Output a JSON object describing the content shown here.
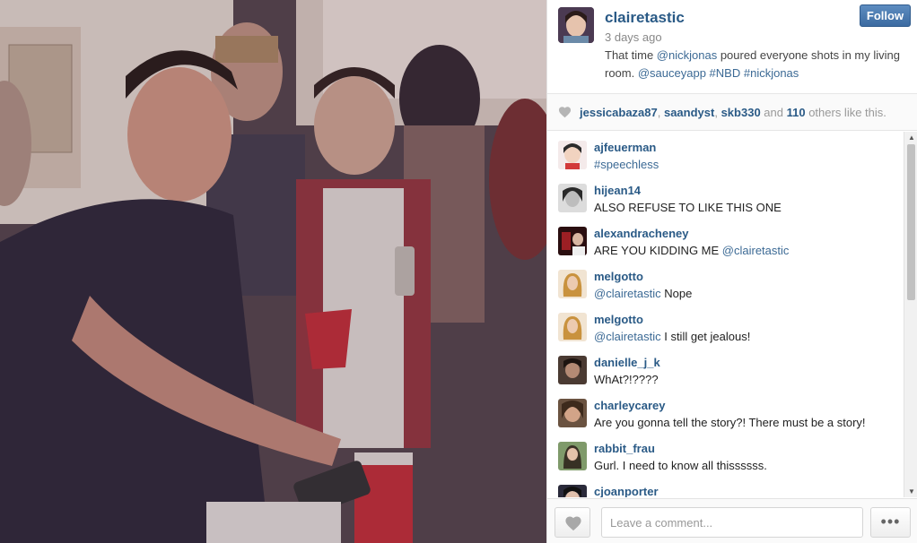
{
  "post": {
    "username": "clairetastic",
    "time": "3 days ago",
    "follow_label": "Follow",
    "caption": {
      "t1": "That time ",
      "m1": "@nickjonas",
      "t2": " poured everyone shots in my living room. ",
      "m2": "@sauceyapp",
      "t3": " ",
      "h1": "#NBD",
      "t4": " ",
      "h2": "#nickjonas"
    }
  },
  "likes": {
    "user1": "jessicabaza87",
    "sep1": ", ",
    "user2": "saandyst",
    "sep2": ", ",
    "user3": "skb330",
    "and": " and ",
    "count": "110",
    "suffix": " others like this."
  },
  "comments": [
    {
      "user": "ajfeuerman",
      "mention": "",
      "text": "#speechless",
      "text_is_tag": true,
      "avatar_color": "#c93c3c"
    },
    {
      "user": "hijean14",
      "mention": "",
      "text": "ALSO REFUSE TO LIKE THIS ONE",
      "avatar_color": "#3a3a3a"
    },
    {
      "user": "alexandracheney",
      "mention": "",
      "text": "ARE YOU KIDDING ME ",
      "mention_after": "@clairetastic",
      "avatar_color": "#7a1e1e"
    },
    {
      "user": "melgotto",
      "mention": "@clairetastic",
      "text": " Nope",
      "avatar_color": "#c89a5a"
    },
    {
      "user": "melgotto",
      "mention": "@clairetastic",
      "text": " I still get jealous!",
      "avatar_color": "#c89a5a"
    },
    {
      "user": "danielle_j_k",
      "mention": "",
      "text": "WhAt?!????",
      "avatar_color": "#5a4a40"
    },
    {
      "user": "charleycarey",
      "mention": "",
      "text": "Are you gonna tell the story?! There must be a story!",
      "avatar_color": "#8a6a4a"
    },
    {
      "user": "rabbit_frau",
      "mention": "",
      "text": "Gurl. I need to know all thissssss.",
      "avatar_color": "#6a7a5a"
    },
    {
      "user": "cjoanporter",
      "mention": "",
      "text": "",
      "avatar_color": "#2a2a3a"
    }
  ],
  "footer": {
    "comment_placeholder": "Leave a comment...",
    "more_label": "•••"
  },
  "icons": {
    "like": "heart-icon",
    "more": "more-dots-icon",
    "scroll_up": "scroll-up-arrow-icon",
    "scroll_down": "scroll-down-arrow-icon"
  },
  "colors": {
    "link": "#3c6a95",
    "username": "#2a5a86",
    "follow_button": "#4a79ae"
  }
}
